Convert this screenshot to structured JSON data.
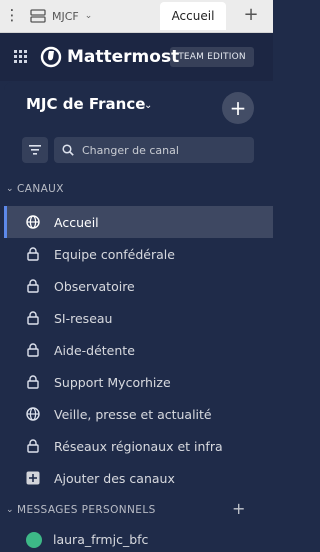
{
  "tabbar": {
    "server_label": "MJCF",
    "active_tab": "Accueil",
    "menu_icon": "vertical-dots-icon",
    "new_tab_icon": "plus-icon"
  },
  "header": {
    "brand": "Mattermost",
    "edition": "TEAM EDITION"
  },
  "team": {
    "name": "MJC de France"
  },
  "search": {
    "placeholder": "Changer de canal"
  },
  "sections": {
    "channels": "CANAUX",
    "direct": "MESSAGES PERSONNELS"
  },
  "channels": [
    {
      "label": "Accueil",
      "icon": "globe-icon",
      "active": true
    },
    {
      "label": "Equipe confédérale",
      "icon": "lock-icon"
    },
    {
      "label": "Observatoire",
      "icon": "lock-icon"
    },
    {
      "label": "SI-reseau",
      "icon": "lock-icon"
    },
    {
      "label": "Aide-détente",
      "icon": "lock-icon"
    },
    {
      "label": "Support Mycorhize",
      "icon": "lock-icon"
    },
    {
      "label": "Veille, presse et actualité",
      "icon": "globe-icon"
    },
    {
      "label": "Réseaux régionaux et infra",
      "icon": "lock-icon"
    },
    {
      "label": "Ajouter des canaux",
      "icon": "plus-box-icon"
    }
  ],
  "direct_messages": [
    {
      "name": "laura_frmjc_bfc"
    }
  ],
  "colors": {
    "sidebar_bg": "#1f2b49",
    "active_indicator": "#5d89ea",
    "tabbar_bg": "#ececec",
    "online_status": "#3db887"
  }
}
